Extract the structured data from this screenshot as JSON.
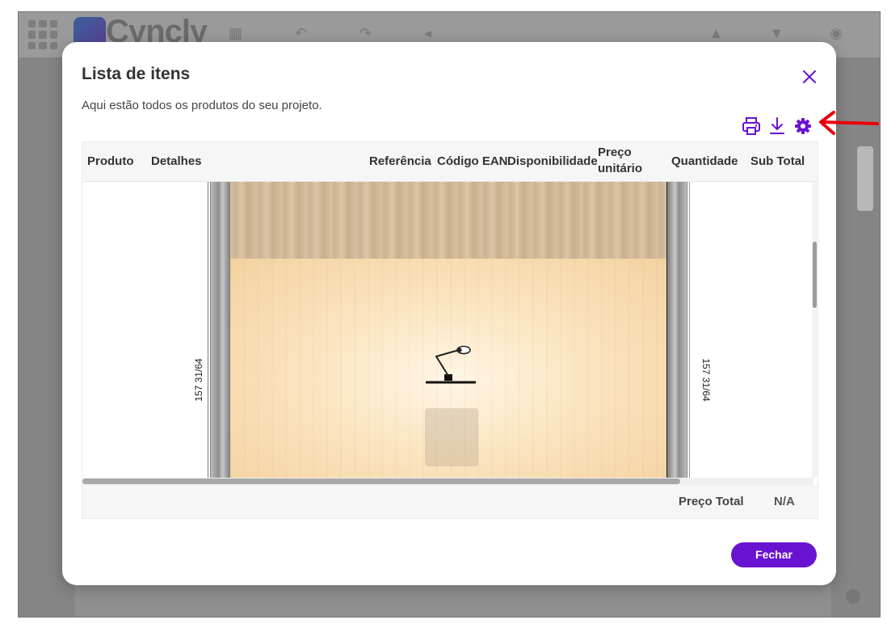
{
  "app": {
    "logo_text": "Cyncly",
    "background_top_icons": "▦ ↶ ↷ ◂",
    "background_right_icons": "▲ ▼ ◉"
  },
  "modal": {
    "title": "Lista de itens",
    "subtitle": "Aqui estão todos os produtos do seu projeto.",
    "close_icon": "close-icon",
    "toolbar": [
      {
        "name": "print-icon"
      },
      {
        "name": "download-icon"
      },
      {
        "name": "gear-icon"
      }
    ],
    "accent_color": "#6a12d2"
  },
  "table": {
    "columns": [
      "Produto",
      "Detalhes",
      "Referência",
      "Código EAN",
      "Disponibilidade",
      "Preço unitário",
      "Quantidade",
      "Sub Total"
    ],
    "preview": {
      "dimension_left": "157 31/64",
      "dimension_right": "157 31/64"
    },
    "footer": {
      "total_label": "Preço Total",
      "total_value": "N/A"
    }
  },
  "actions": {
    "close_label": "Fechar"
  },
  "annotation": {
    "arrow_color": "#e8000b"
  }
}
